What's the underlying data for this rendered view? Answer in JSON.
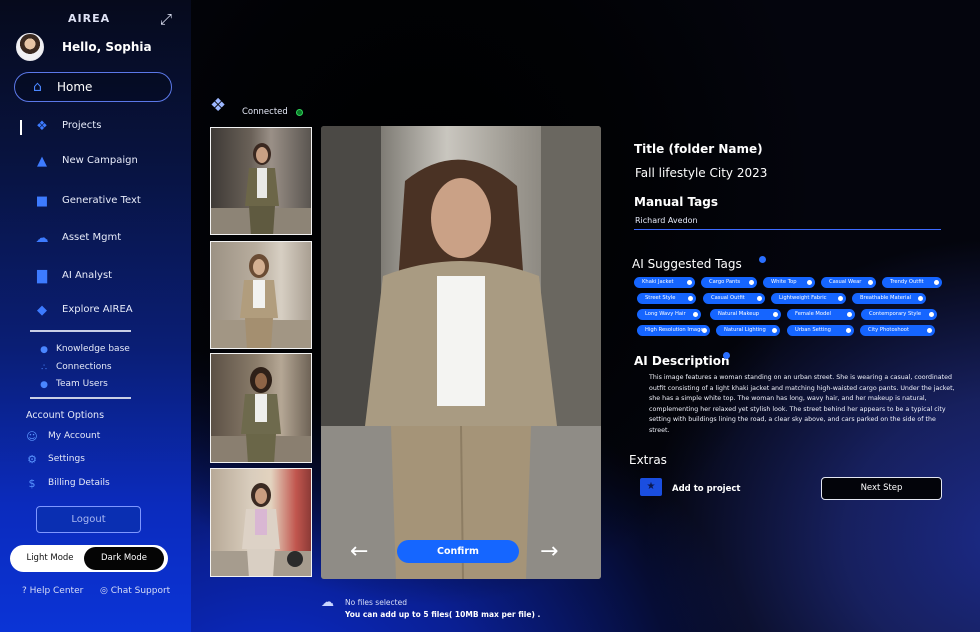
{
  "app": {
    "logo": "AIREA",
    "greeting": "Hello, Sophia"
  },
  "sidebar": {
    "home": "Home",
    "items": [
      {
        "label": "Projects",
        "icon": "projects-icon"
      },
      {
        "label": "New Campaign",
        "icon": "flame-icon"
      },
      {
        "label": "Generative Text",
        "icon": "chat-icon"
      },
      {
        "label": "Asset Mgmt",
        "icon": "cloud-icon"
      },
      {
        "label": "AI Analyst",
        "icon": "chart-icon"
      },
      {
        "label": "Explore AIREA",
        "icon": "graduation-cap-icon"
      }
    ],
    "sub": [
      {
        "label": "Knowledge base",
        "icon": "brain-icon"
      },
      {
        "label": "Connections",
        "icon": "nodes-icon"
      },
      {
        "label": "Team Users",
        "icon": "users-icon"
      }
    ],
    "account_title": "Account Options",
    "account": [
      {
        "label": "My Account",
        "icon": "user-icon"
      },
      {
        "label": "Settings",
        "icon": "gear-icon"
      },
      {
        "label": "Billing Details",
        "icon": "dollar-icon"
      }
    ],
    "logout": "Logout",
    "mode": {
      "light": "Light Mode",
      "dark": "Dark Mode",
      "active": "Dark Mode"
    },
    "help": "Help Center",
    "chat": "Chat Support"
  },
  "upload": {
    "status": "Connected",
    "confirm": "Confirm",
    "no_files": "No files selected",
    "limit": "You can add up to 5 files( 10MB max per file) ."
  },
  "details": {
    "title_heading": "Title (folder Name)",
    "title_value": "Fall lifestyle City 2023",
    "manual_heading": "Manual Tags",
    "manual_value": "Richard Avedon",
    "ai_tags_heading": "AI Suggested Tags",
    "ai_tags": [
      "Khaki Jacket",
      "Cargo Pants",
      "White Top",
      "Casual Wear",
      "Trendy Outfit",
      "Street Style",
      "Casual Outfit",
      "Lightweight Fabric",
      "Breathable Material",
      "Long Wavy Hair",
      "Natural Makeup",
      "Female Model",
      "Contemporary Style",
      "High Resolution Image",
      "Natural Lighting",
      "Urban Setting",
      "City Photoshoot"
    ],
    "desc_heading": "AI Description",
    "description": "This image features a woman standing on an urban street. She is wearing a casual, coordinated outfit consisting of a light khaki jacket and matching high-waisted cargo pants. Under the jacket, she has a simple white top. The woman has long, wavy hair, and her makeup is natural, complementing her relaxed yet stylish look. The street behind her appears to be a typical city setting with buildings lining the road, a clear sky above, and cars parked on the side of the street.",
    "extras_heading": "Extras",
    "add_to_project": "Add to project",
    "next_step": "Next Step"
  },
  "colors": {
    "accent": "#1565ff",
    "sidebar_bottom": "#0b34d6",
    "connected": "#2fd65a"
  }
}
